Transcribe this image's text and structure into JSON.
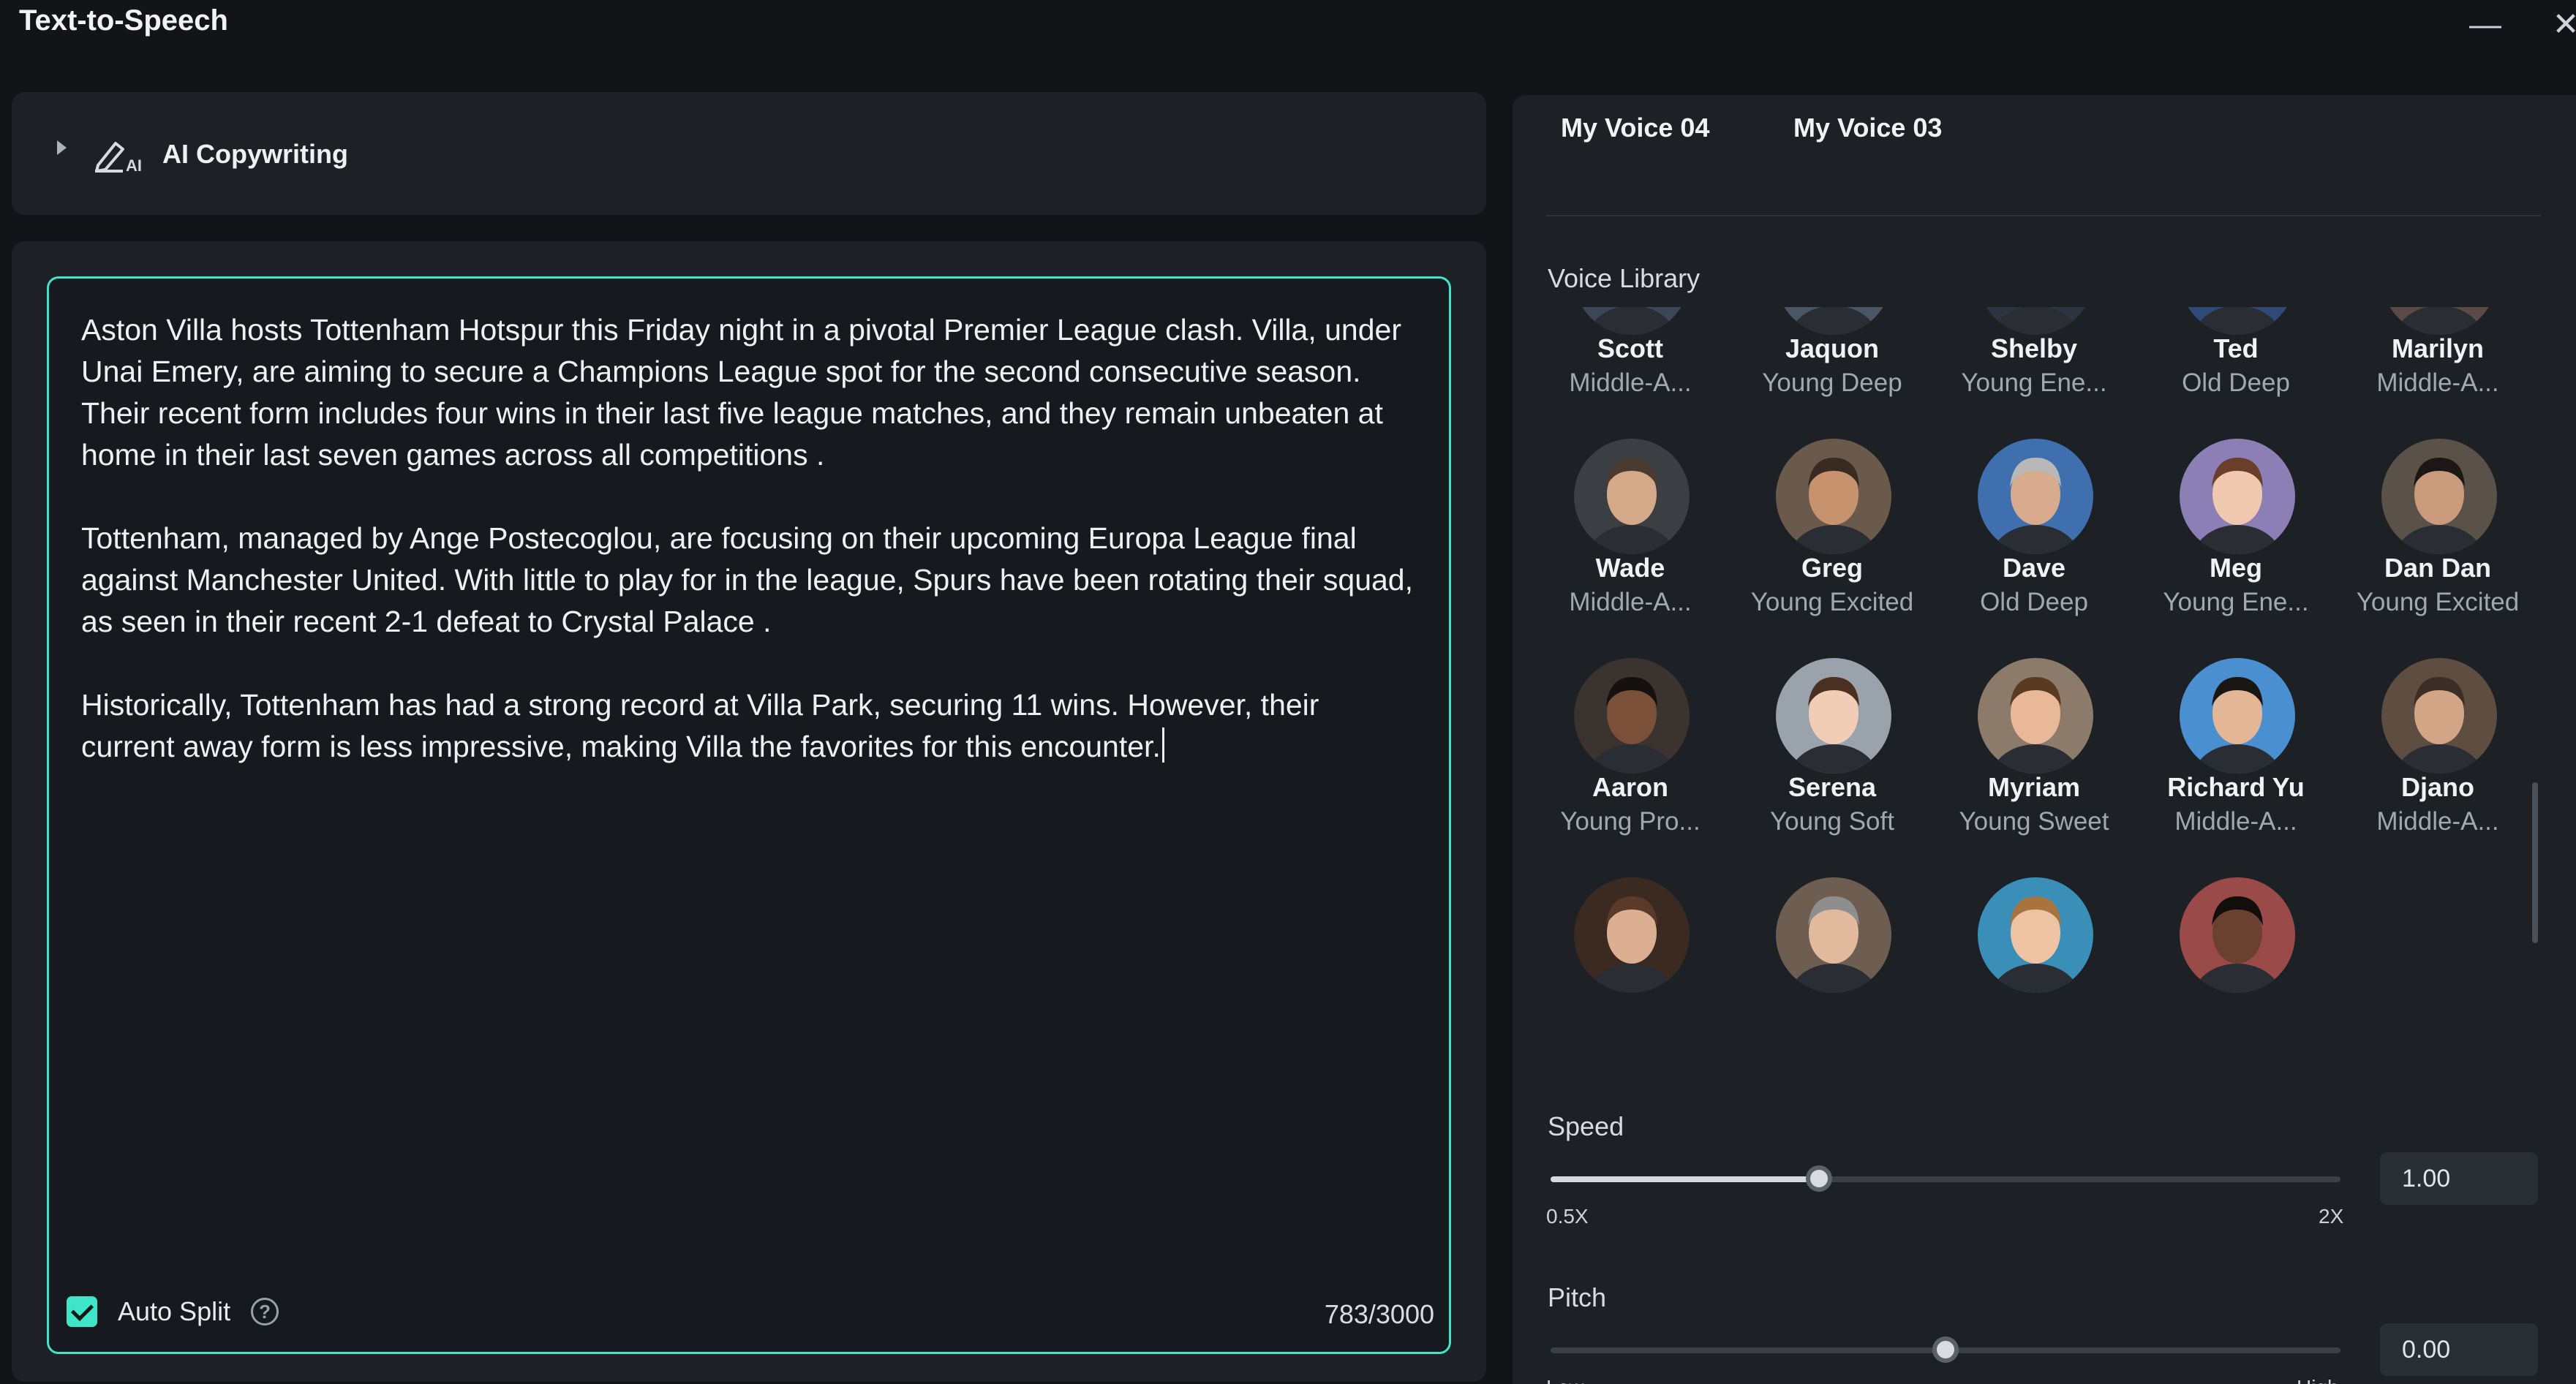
{
  "window": {
    "title": "Text-to-Speech",
    "minimize_icon": "minimize-icon",
    "close_icon": "close-icon"
  },
  "copywriting": {
    "label": "AI Copywriting",
    "icon": "ai-pen-icon",
    "expanded": false
  },
  "editor": {
    "paragraphs": [
      "Aston Villa hosts Tottenham Hotspur this Friday night in a pivotal Premier League clash. Villa, under Unai Emery, are aiming to secure a Champions League spot for the second consecutive season. Their recent form includes four wins in their last five league matches, and they remain unbeaten at home in their last seven games across all competitions .",
      "Tottenham, managed by Ange Postecoglou, are focusing on their upcoming Europa League final against Manchester United. With little to play for in the league, Spurs have been rotating their squad, as seen in their recent 2-1 defeat to Crystal Palace .",
      "Historically, Tottenham has had a strong record at Villa Park, securing 11 wins. However, their current away form is less impressive, making Villa the favorites for this encounter."
    ],
    "auto_split_label": "Auto Split",
    "auto_split_checked": true,
    "char_count": "783/3000",
    "accent_color": "#3ee6c7"
  },
  "tabs": [
    {
      "label": "My Voice 04"
    },
    {
      "label": "My Voice 03"
    }
  ],
  "voice_library": {
    "label": "Voice Library",
    "voices": [
      {
        "name": "Scott",
        "desc": "Middle-A..."
      },
      {
        "name": "Jaquon",
        "desc": "Young Deep"
      },
      {
        "name": "Shelby",
        "desc": "Young Ene..."
      },
      {
        "name": "Ted",
        "desc": "Old Deep"
      },
      {
        "name": "Marilyn",
        "desc": "Middle-A..."
      },
      {
        "name": "Wade",
        "desc": "Middle-A..."
      },
      {
        "name": "Greg",
        "desc": "Young Excited"
      },
      {
        "name": "Dave",
        "desc": "Old Deep"
      },
      {
        "name": "Meg",
        "desc": "Young Ene..."
      },
      {
        "name": "Dan Dan",
        "desc": "Young Excited"
      },
      {
        "name": "Aaron",
        "desc": "Young Pro..."
      },
      {
        "name": "Serena",
        "desc": "Young Soft"
      },
      {
        "name": "Myriam",
        "desc": "Young Sweet"
      },
      {
        "name": "Richard Yu",
        "desc": "Middle-A..."
      },
      {
        "name": "Djano",
        "desc": "Middle-A..."
      },
      {
        "name": "",
        "desc": ""
      },
      {
        "name": "",
        "desc": ""
      },
      {
        "name": "",
        "desc": ""
      },
      {
        "name": "",
        "desc": ""
      }
    ]
  },
  "speed": {
    "label": "Speed",
    "value": "1.00",
    "min_label": "0.5X",
    "max_label": "2X",
    "fraction": 0.34
  },
  "pitch": {
    "label": "Pitch",
    "value": "0.00",
    "min_label": "Low",
    "max_label": "High",
    "fraction": 0.5
  }
}
